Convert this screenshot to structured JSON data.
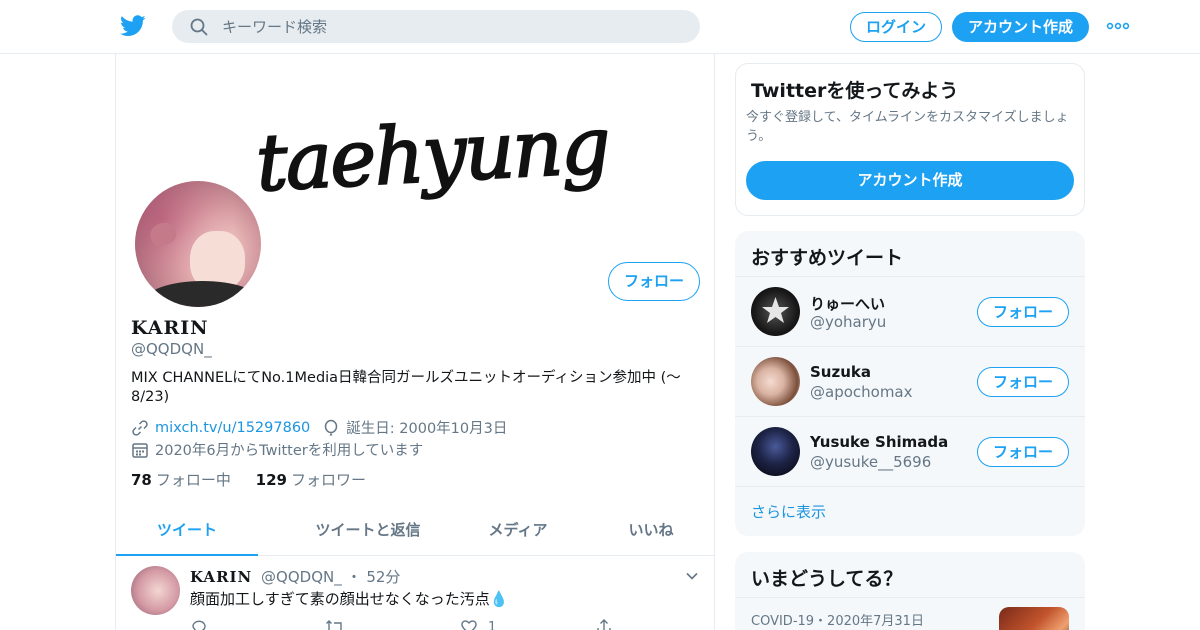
{
  "header": {
    "search_placeholder": "キーワード検索",
    "login_label": "ログイン",
    "signup_label": "アカウント作成",
    "brand_color": "#1da1f2"
  },
  "banner": {
    "handwriting": "taehyung"
  },
  "profile": {
    "name": "KARIN",
    "handle": "@QQDQN_",
    "follow_label": "フォロー",
    "bio": "MIX CHANNELにてNo.1Media日韓合同ガールズユニットオーディション参加中 (〜8/23)",
    "link": "mixch.tv/u/15297860",
    "birthday": "誕生日: 2000年10月3日",
    "joined": "2020年6月からTwitterを利用しています",
    "following_count": "78",
    "following_label": "フォロー中",
    "followers_count": "129",
    "followers_label": "フォロワー"
  },
  "tabs": [
    {
      "label": "ツイート",
      "active": true
    },
    {
      "label": "ツイートと返信",
      "active": false
    },
    {
      "label": "メディア",
      "active": false
    },
    {
      "label": "いいね",
      "active": false
    }
  ],
  "tweet": {
    "name": "KARIN",
    "handle": "@QQDQN_",
    "sep": "・",
    "time": "52分",
    "text": "顔面加工しすぎて素の顔出せなくなった汚点",
    "emoji": "💧",
    "like_count": "1"
  },
  "sidebar": {
    "signup_card": {
      "title": "Twitterを使ってみよう",
      "text": "今すぐ登録して、タイムラインをカスタマイズしましょう。",
      "button": "アカウント作成"
    },
    "recommend": {
      "title": "おすすめツイート",
      "follow_label": "フォロー",
      "users": [
        {
          "name": "りゅーへい",
          "handle": "@yoharyu"
        },
        {
          "name": "Suzuka",
          "handle": "@apochomax"
        },
        {
          "name": "Yusuke Shimada",
          "handle": "@yusuke__5696"
        }
      ],
      "show_more": "さらに表示"
    },
    "trends": {
      "title": "いまどうしてる？",
      "meta": "COVID-19・2020年7月31日"
    }
  }
}
